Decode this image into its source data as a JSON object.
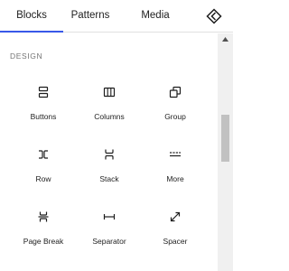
{
  "tabs": [
    {
      "label": "Blocks",
      "active": true
    },
    {
      "label": "Patterns",
      "active": false
    },
    {
      "label": "Media",
      "active": false
    }
  ],
  "close_icon": "close-inserter-icon",
  "category": "DESIGN",
  "blocks": [
    {
      "label": "Buttons",
      "icon": "buttons-icon"
    },
    {
      "label": "Columns",
      "icon": "columns-icon"
    },
    {
      "label": "Group",
      "icon": "group-icon"
    },
    {
      "label": "Row",
      "icon": "row-icon"
    },
    {
      "label": "Stack",
      "icon": "stack-icon"
    },
    {
      "label": "More",
      "icon": "more-icon"
    },
    {
      "label": "Page Break",
      "icon": "page-break-icon"
    },
    {
      "label": "Separator",
      "icon": "separator-icon"
    },
    {
      "label": "Spacer",
      "icon": "spacer-icon"
    }
  ],
  "colors": {
    "accent": "#3858e9",
    "text": "#1e1e1e",
    "muted": "#757575"
  }
}
